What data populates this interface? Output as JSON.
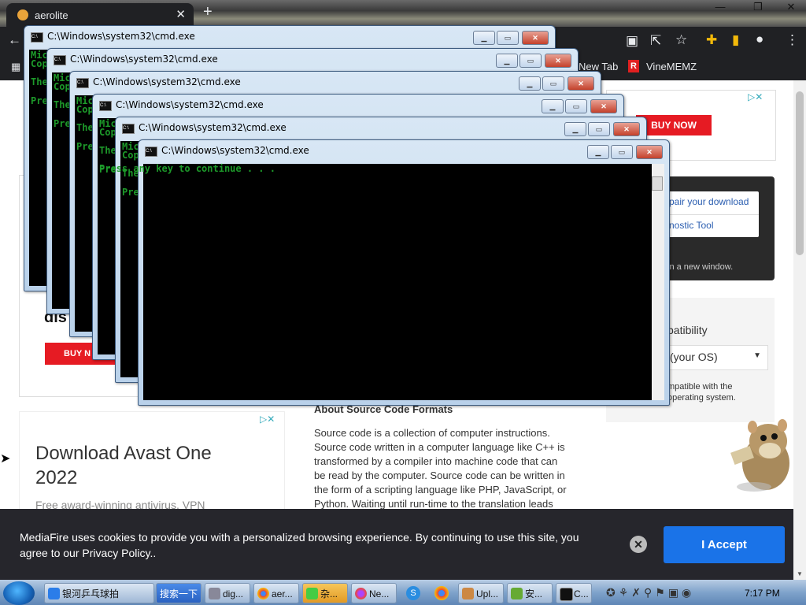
{
  "browser": {
    "tab_title": "aerolite",
    "tab_close": "✕",
    "new_tab": "+",
    "bookmarks": [
      "New Tab",
      "VineMEMZ"
    ]
  },
  "page": {
    "buy_now": "BUY NOW",
    "repair_option": "pair your download",
    "diag_option": "nostic Tool",
    "new_window_note": "in a new window.",
    "compat_heading": "patibility",
    "os_select": "(your OS)",
    "compat_note_1": "mpatible with the",
    "compat_note_2": "operating system.",
    "left_partial": "dis",
    "buy_partial": "BUY N",
    "avast_title": "Download Avast One 2022",
    "avast_sub": "Free award-winning antivirus, VPN",
    "source_heading": "About Source Code Formats",
    "source_text": "Source code is a collection of computer instructions. Source code written in a computer language like C++ is transformed by a compiler into machine code that can be read by the computer. Source code can be written in the form of a scripting language like PHP, JavaScript, or Python. Waiting until run-time to the translation leads"
  },
  "cookie": {
    "text": "MediaFire uses cookies to provide you with a personalized browsing experience. By continuing to use this site, you agree to our Privacy Policy..",
    "close": "✕",
    "accept": "I Accept"
  },
  "cmd": {
    "title": "C:\\Windows\\system32\\cmd.exe",
    "l1": "Mic",
    "l2": "Cop",
    "l3": "The co",
    "l4": "Press",
    "press": "Press any key to continue . . ."
  },
  "taskbar": {
    "items": [
      "银河乒乓球拍",
      "搜索一下",
      "dig...",
      "aer...",
      "杂...",
      "Ne...",
      "Upl...",
      "安...",
      "C..."
    ],
    "clock": "7:17 PM"
  }
}
